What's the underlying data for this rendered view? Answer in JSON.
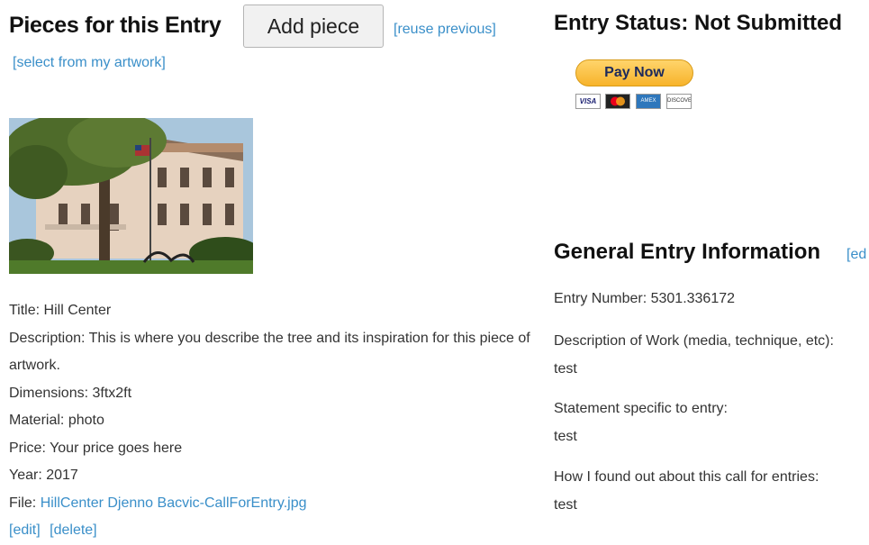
{
  "pieces": {
    "title": "Pieces for this Entry",
    "add_piece_label": "Add piece",
    "reuse_previous": "[reuse previous]",
    "select_from_artwork": "[select from my artwork]",
    "piece": {
      "title_label": "Title:",
      "title": "Hill Center",
      "description_label": "Description:",
      "description": "This is where you describe the tree and its inspiration for this piece of artwork.",
      "dimensions_label": "Dimensions:",
      "dimensions": "3ftx2ft",
      "material_label": "Material:",
      "material": "photo",
      "price_label": "Price:",
      "price": "Your price goes here",
      "year_label": "Year:",
      "year": "2017",
      "file_label": "File:",
      "file": "HillCenter Djenno Bacvic-CallForEntry.jpg",
      "edit": "[edit]",
      "delete": "[delete]"
    }
  },
  "status": {
    "title": "Entry Status: Not Submitted",
    "pay_now": "Pay Now",
    "cards": [
      "VISA",
      "MC",
      "AMEX",
      "DISCOVER"
    ]
  },
  "general": {
    "title": "General Entry Information",
    "edit": "[ed",
    "entry_number_label": "Entry Number:",
    "entry_number": "5301.336172",
    "description_label": "Description of Work (media, technique, etc):",
    "description": "test",
    "statement_label": "Statement specific to entry:",
    "statement": "test",
    "found_label": "How I found out about this call for entries:",
    "found": "test"
  },
  "colors": {
    "link": "#3a8fc9",
    "text": "#333333",
    "paypal_gold": "#f7b32b"
  }
}
